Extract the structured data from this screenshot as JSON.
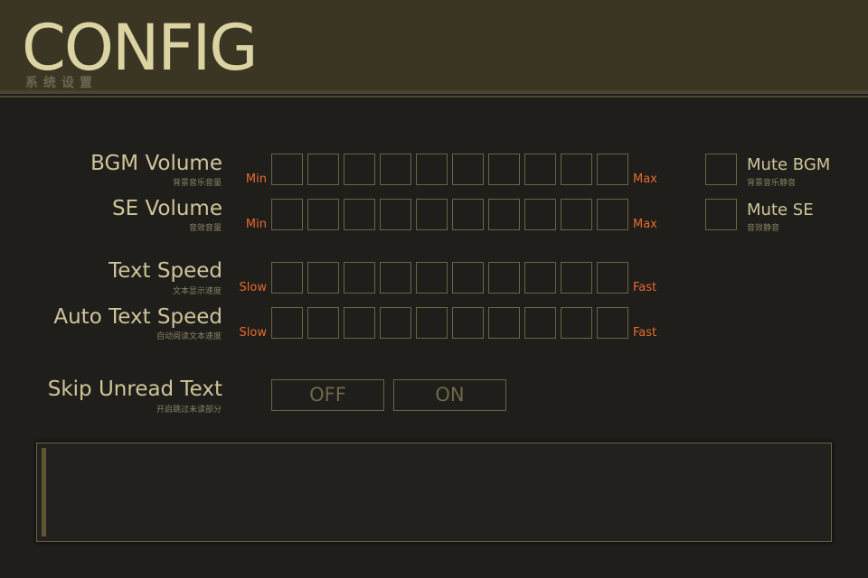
{
  "header": {
    "title": "CONFIG",
    "subtitle": "系统设置"
  },
  "settings": {
    "bgm_volume": {
      "label": "BGM Volume",
      "sublabel": "背景音乐音量",
      "min_label": "Min",
      "max_label": "Max",
      "level": 0,
      "steps": 10
    },
    "se_volume": {
      "label": "SE Volume",
      "sublabel": "音效音量",
      "min_label": "Min",
      "max_label": "Max",
      "level": 0,
      "steps": 10
    },
    "text_speed": {
      "label": "Text Speed",
      "sublabel": "文本显示速度",
      "min_label": "Slow",
      "max_label": "Fast",
      "level": 0,
      "steps": 10
    },
    "auto_text_speed": {
      "label": "Auto Text Speed",
      "sublabel": "自动阅读文本速度",
      "min_label": "Slow",
      "max_label": "Fast",
      "level": 0,
      "steps": 10
    },
    "skip_unread": {
      "label": "Skip Unread Text",
      "sublabel": "开启跳过未读部分",
      "off_label": "OFF",
      "on_label": "ON"
    }
  },
  "mute": {
    "bgm": {
      "label": "Mute BGM",
      "sublabel": "背景音乐静音",
      "checked": false
    },
    "se": {
      "label": "Mute SE",
      "sublabel": "音效静音",
      "checked": false
    }
  },
  "colors": {
    "accent": "#e66a2e",
    "text": "#cfc59a",
    "border": "#6b6444",
    "background": "#1f1e1b",
    "header": "#3b3524"
  }
}
